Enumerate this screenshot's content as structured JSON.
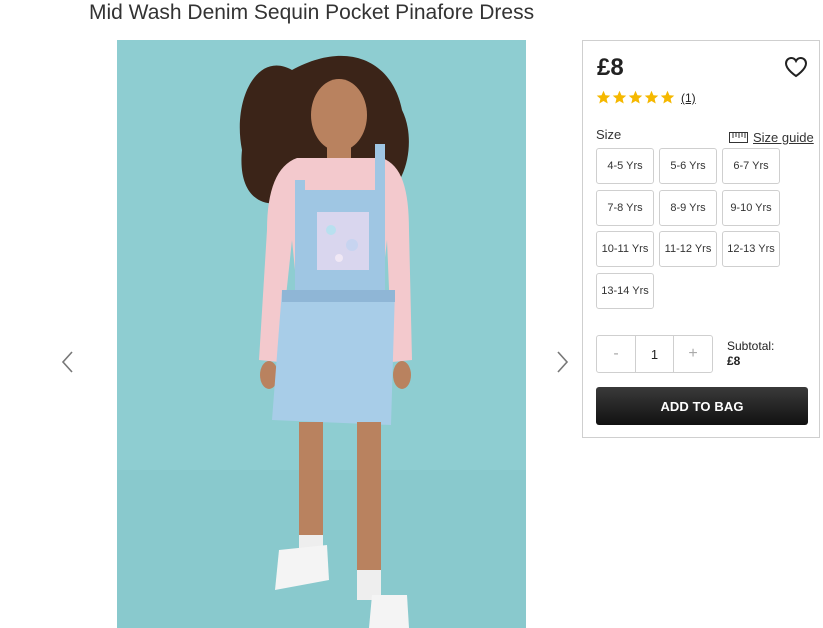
{
  "product": {
    "title": "Mid Wash Denim Sequin Pocket Pinafore Dress",
    "price": "£8",
    "rating_stars": 5,
    "review_count": "(1)"
  },
  "gallery": {
    "image_icon": "product-photo",
    "prev_icon": "chevron-left-icon",
    "next_icon": "chevron-right-icon"
  },
  "size": {
    "label": "Size",
    "guide_label": "Size guide",
    "options": [
      "4-5 Yrs",
      "5-6 Yrs",
      "6-7 Yrs",
      "7-8 Yrs",
      "8-9 Yrs",
      "9-10 Yrs",
      "10-11 Yrs",
      "11-12 Yrs",
      "12-13 Yrs",
      "13-14 Yrs"
    ]
  },
  "quantity": {
    "minus": "-",
    "value": "1",
    "plus": "+"
  },
  "subtotal": {
    "label": "Subtotal:",
    "amount": "£8"
  },
  "actions": {
    "add_to_bag": "ADD TO BAG"
  },
  "colors": {
    "star": "#f5b800",
    "button_bg": "#1f1f1f",
    "image_bg": "#8ecdd1"
  }
}
